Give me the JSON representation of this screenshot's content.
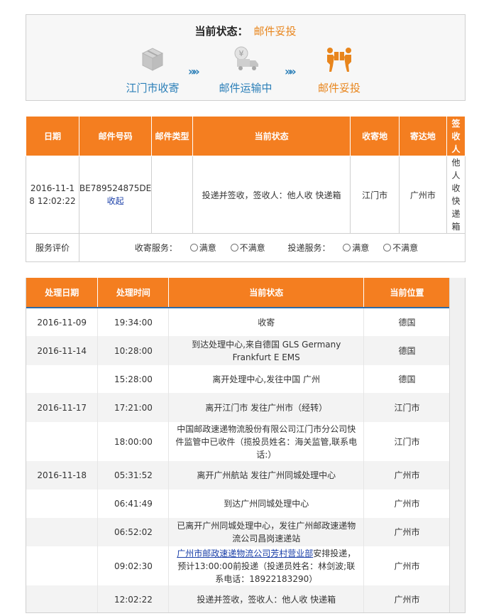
{
  "status": {
    "label": "当前状态：",
    "value": "邮件妥投",
    "steps": [
      {
        "icon": "package-box-icon",
        "label": "江门市收寄"
      },
      {
        "icon": "delivery-truck-icon",
        "label": "邮件运输中"
      },
      {
        "icon": "courier-delivering-icon",
        "label": "邮件妥投"
      }
    ],
    "arrow": "»»"
  },
  "mail_table": {
    "headers": [
      "日期",
      "邮件号码",
      "邮件类型",
      "当前状态",
      "收寄地",
      "寄达地",
      "签收人"
    ],
    "row": {
      "date": "2016-11-18 12:02:22",
      "number": "BE789524875DE",
      "collapse": "收起",
      "type": "",
      "status": "投递并签收，签收人：他人收 快递箱",
      "origin": "江门市",
      "destination": "广州市",
      "signer": "他人收快递箱"
    },
    "rating": {
      "label": "服务评价",
      "collect_label": "收寄服务：",
      "deliver_label": "投递服务：",
      "satisfied": "满意",
      "unsatisfied": "不满意"
    }
  },
  "tracking": {
    "headers": [
      "处理日期",
      "处理时间",
      "当前状态",
      "当前位置"
    ],
    "rows": [
      {
        "date": "2016-11-09",
        "time": "19:34:00",
        "status": "收寄",
        "location": "德国"
      },
      {
        "date": "2016-11-14",
        "time": "10:28:00",
        "status": "到达处理中心,来自德国 GLS Germany Frankfurt E EMS",
        "location": "德国"
      },
      {
        "date": "",
        "time": "15:28:00",
        "status": "离开处理中心,发往中国 广州",
        "location": "德国"
      },
      {
        "date": "2016-11-17",
        "time": "17:21:00",
        "status": "离开江门市 发往广州市（经转）",
        "location": "江门市"
      },
      {
        "date": "",
        "time": "18:00:00",
        "status": "中国邮政速递物流股份有限公司江门市分公司快件监管中已收件（揽投员姓名：海关监管,联系电话:）",
        "location": "江门市"
      },
      {
        "date": "2016-11-18",
        "time": "05:31:52",
        "status": "离开广州航站 发往广州同城处理中心",
        "location": "广州市"
      },
      {
        "date": "",
        "time": "06:41:49",
        "status": "到达广州同城处理中心",
        "location": "广州市"
      },
      {
        "date": "",
        "time": "06:52:02",
        "status": "已离开广州同城处理中心，发往广州邮政速递物流公司昌岗速递站",
        "location": "广州市"
      },
      {
        "date": "",
        "time": "09:02:30",
        "status_link": "广州市邮政速递物流公司芳村营业部",
        "status": "安排投递，预计13:00:00前投递（投递员姓名：林剑波;联系电话：18922183290）",
        "location": "广州市"
      },
      {
        "date": "",
        "time": "12:02:22",
        "status": "投递并签收，签收人：他人收 快递箱",
        "location": "广州市"
      }
    ]
  }
}
